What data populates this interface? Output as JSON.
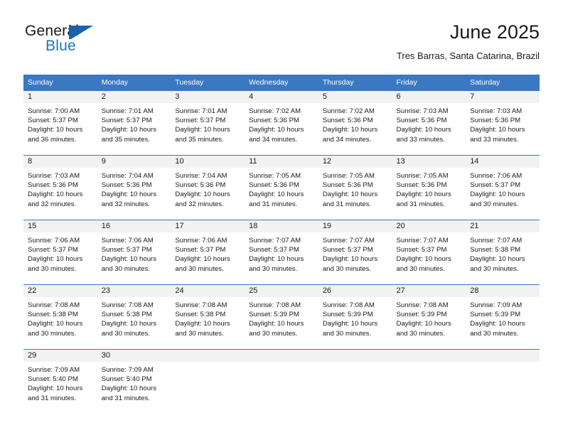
{
  "brand": {
    "name_top": "General",
    "name_bottom": "Blue",
    "accent_color": "#1b75bb",
    "triangle_color": "#1b62ad",
    "logo_icon": "triangle-flag-icon"
  },
  "header": {
    "title": "June 2025",
    "subtitle": "Tres Barras, Santa Catarina, Brazil"
  },
  "colors": {
    "header_row_bg": "#3a78c2",
    "header_row_text": "#ffffff",
    "daynum_strip_bg": "#f2f2f2",
    "cell_text": "#1a1a1a",
    "row_divider": "#3a78c2"
  },
  "weekday_headers": [
    "Sunday",
    "Monday",
    "Tuesday",
    "Wednesday",
    "Thursday",
    "Friday",
    "Saturday"
  ],
  "weeks": [
    [
      {
        "day": "1",
        "sunrise": "Sunrise: 7:00 AM",
        "sunset": "Sunset: 5:37 PM",
        "daylight_line1": "Daylight: 10 hours",
        "daylight_line2": "and 36 minutes."
      },
      {
        "day": "2",
        "sunrise": "Sunrise: 7:01 AM",
        "sunset": "Sunset: 5:37 PM",
        "daylight_line1": "Daylight: 10 hours",
        "daylight_line2": "and 35 minutes."
      },
      {
        "day": "3",
        "sunrise": "Sunrise: 7:01 AM",
        "sunset": "Sunset: 5:37 PM",
        "daylight_line1": "Daylight: 10 hours",
        "daylight_line2": "and 35 minutes."
      },
      {
        "day": "4",
        "sunrise": "Sunrise: 7:02 AM",
        "sunset": "Sunset: 5:36 PM",
        "daylight_line1": "Daylight: 10 hours",
        "daylight_line2": "and 34 minutes."
      },
      {
        "day": "5",
        "sunrise": "Sunrise: 7:02 AM",
        "sunset": "Sunset: 5:36 PM",
        "daylight_line1": "Daylight: 10 hours",
        "daylight_line2": "and 34 minutes."
      },
      {
        "day": "6",
        "sunrise": "Sunrise: 7:03 AM",
        "sunset": "Sunset: 5:36 PM",
        "daylight_line1": "Daylight: 10 hours",
        "daylight_line2": "and 33 minutes."
      },
      {
        "day": "7",
        "sunrise": "Sunrise: 7:03 AM",
        "sunset": "Sunset: 5:36 PM",
        "daylight_line1": "Daylight: 10 hours",
        "daylight_line2": "and 33 minutes."
      }
    ],
    [
      {
        "day": "8",
        "sunrise": "Sunrise: 7:03 AM",
        "sunset": "Sunset: 5:36 PM",
        "daylight_line1": "Daylight: 10 hours",
        "daylight_line2": "and 32 minutes."
      },
      {
        "day": "9",
        "sunrise": "Sunrise: 7:04 AM",
        "sunset": "Sunset: 5:36 PM",
        "daylight_line1": "Daylight: 10 hours",
        "daylight_line2": "and 32 minutes."
      },
      {
        "day": "10",
        "sunrise": "Sunrise: 7:04 AM",
        "sunset": "Sunset: 5:36 PM",
        "daylight_line1": "Daylight: 10 hours",
        "daylight_line2": "and 32 minutes."
      },
      {
        "day": "11",
        "sunrise": "Sunrise: 7:05 AM",
        "sunset": "Sunset: 5:36 PM",
        "daylight_line1": "Daylight: 10 hours",
        "daylight_line2": "and 31 minutes."
      },
      {
        "day": "12",
        "sunrise": "Sunrise: 7:05 AM",
        "sunset": "Sunset: 5:36 PM",
        "daylight_line1": "Daylight: 10 hours",
        "daylight_line2": "and 31 minutes."
      },
      {
        "day": "13",
        "sunrise": "Sunrise: 7:05 AM",
        "sunset": "Sunset: 5:36 PM",
        "daylight_line1": "Daylight: 10 hours",
        "daylight_line2": "and 31 minutes."
      },
      {
        "day": "14",
        "sunrise": "Sunrise: 7:06 AM",
        "sunset": "Sunset: 5:37 PM",
        "daylight_line1": "Daylight: 10 hours",
        "daylight_line2": "and 30 minutes."
      }
    ],
    [
      {
        "day": "15",
        "sunrise": "Sunrise: 7:06 AM",
        "sunset": "Sunset: 5:37 PM",
        "daylight_line1": "Daylight: 10 hours",
        "daylight_line2": "and 30 minutes."
      },
      {
        "day": "16",
        "sunrise": "Sunrise: 7:06 AM",
        "sunset": "Sunset: 5:37 PM",
        "daylight_line1": "Daylight: 10 hours",
        "daylight_line2": "and 30 minutes."
      },
      {
        "day": "17",
        "sunrise": "Sunrise: 7:06 AM",
        "sunset": "Sunset: 5:37 PM",
        "daylight_line1": "Daylight: 10 hours",
        "daylight_line2": "and 30 minutes."
      },
      {
        "day": "18",
        "sunrise": "Sunrise: 7:07 AM",
        "sunset": "Sunset: 5:37 PM",
        "daylight_line1": "Daylight: 10 hours",
        "daylight_line2": "and 30 minutes."
      },
      {
        "day": "19",
        "sunrise": "Sunrise: 7:07 AM",
        "sunset": "Sunset: 5:37 PM",
        "daylight_line1": "Daylight: 10 hours",
        "daylight_line2": "and 30 minutes."
      },
      {
        "day": "20",
        "sunrise": "Sunrise: 7:07 AM",
        "sunset": "Sunset: 5:37 PM",
        "daylight_line1": "Daylight: 10 hours",
        "daylight_line2": "and 30 minutes."
      },
      {
        "day": "21",
        "sunrise": "Sunrise: 7:07 AM",
        "sunset": "Sunset: 5:38 PM",
        "daylight_line1": "Daylight: 10 hours",
        "daylight_line2": "and 30 minutes."
      }
    ],
    [
      {
        "day": "22",
        "sunrise": "Sunrise: 7:08 AM",
        "sunset": "Sunset: 5:38 PM",
        "daylight_line1": "Daylight: 10 hours",
        "daylight_line2": "and 30 minutes."
      },
      {
        "day": "23",
        "sunrise": "Sunrise: 7:08 AM",
        "sunset": "Sunset: 5:38 PM",
        "daylight_line1": "Daylight: 10 hours",
        "daylight_line2": "and 30 minutes."
      },
      {
        "day": "24",
        "sunrise": "Sunrise: 7:08 AM",
        "sunset": "Sunset: 5:38 PM",
        "daylight_line1": "Daylight: 10 hours",
        "daylight_line2": "and 30 minutes."
      },
      {
        "day": "25",
        "sunrise": "Sunrise: 7:08 AM",
        "sunset": "Sunset: 5:39 PM",
        "daylight_line1": "Daylight: 10 hours",
        "daylight_line2": "and 30 minutes."
      },
      {
        "day": "26",
        "sunrise": "Sunrise: 7:08 AM",
        "sunset": "Sunset: 5:39 PM",
        "daylight_line1": "Daylight: 10 hours",
        "daylight_line2": "and 30 minutes."
      },
      {
        "day": "27",
        "sunrise": "Sunrise: 7:08 AM",
        "sunset": "Sunset: 5:39 PM",
        "daylight_line1": "Daylight: 10 hours",
        "daylight_line2": "and 30 minutes."
      },
      {
        "day": "28",
        "sunrise": "Sunrise: 7:09 AM",
        "sunset": "Sunset: 5:39 PM",
        "daylight_line1": "Daylight: 10 hours",
        "daylight_line2": "and 30 minutes."
      }
    ],
    [
      {
        "day": "29",
        "sunrise": "Sunrise: 7:09 AM",
        "sunset": "Sunset: 5:40 PM",
        "daylight_line1": "Daylight: 10 hours",
        "daylight_line2": "and 31 minutes."
      },
      {
        "day": "30",
        "sunrise": "Sunrise: 7:09 AM",
        "sunset": "Sunset: 5:40 PM",
        "daylight_line1": "Daylight: 10 hours",
        "daylight_line2": "and 31 minutes."
      },
      {
        "day": "",
        "sunrise": "",
        "sunset": "",
        "daylight_line1": "",
        "daylight_line2": ""
      },
      {
        "day": "",
        "sunrise": "",
        "sunset": "",
        "daylight_line1": "",
        "daylight_line2": ""
      },
      {
        "day": "",
        "sunrise": "",
        "sunset": "",
        "daylight_line1": "",
        "daylight_line2": ""
      },
      {
        "day": "",
        "sunrise": "",
        "sunset": "",
        "daylight_line1": "",
        "daylight_line2": ""
      },
      {
        "day": "",
        "sunrise": "",
        "sunset": "",
        "daylight_line1": "",
        "daylight_line2": ""
      }
    ]
  ]
}
